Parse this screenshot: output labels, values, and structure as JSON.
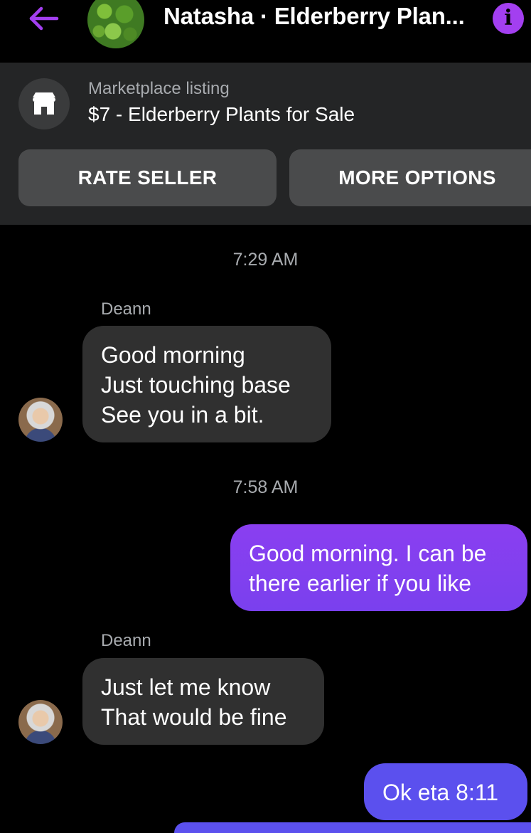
{
  "header": {
    "title": "Natasha · Elderberry Plan...",
    "back_icon": "arrow-left-icon",
    "info_icon": "info-icon",
    "info_glyph": "i",
    "accent_color": "#a33ff0"
  },
  "listing": {
    "label": "Marketplace listing",
    "title": "$7 - Elderberry Plants for Sale",
    "icon": "storefront-icon",
    "buttons": {
      "rate_seller": "RATE SELLER",
      "more_options": "MORE OPTIONS"
    }
  },
  "messages": {
    "ts1": "7:29 AM",
    "ts2": "7:58 AM",
    "sender1": "Deann",
    "sender2": "Deann",
    "m1": [
      "Good morning",
      "Just touching base",
      "See you in a bit."
    ],
    "m2": [
      "Good morning. I can be",
      "there earlier if you like"
    ],
    "m3": [
      "Just let me know",
      "That would be fine"
    ],
    "m4": "Ok eta 8:11"
  },
  "colors": {
    "outgoing_bubble_top": "#8a3ff0",
    "outgoing_bubble_bottom": "#5b50ee",
    "incoming_bubble": "#303030"
  }
}
